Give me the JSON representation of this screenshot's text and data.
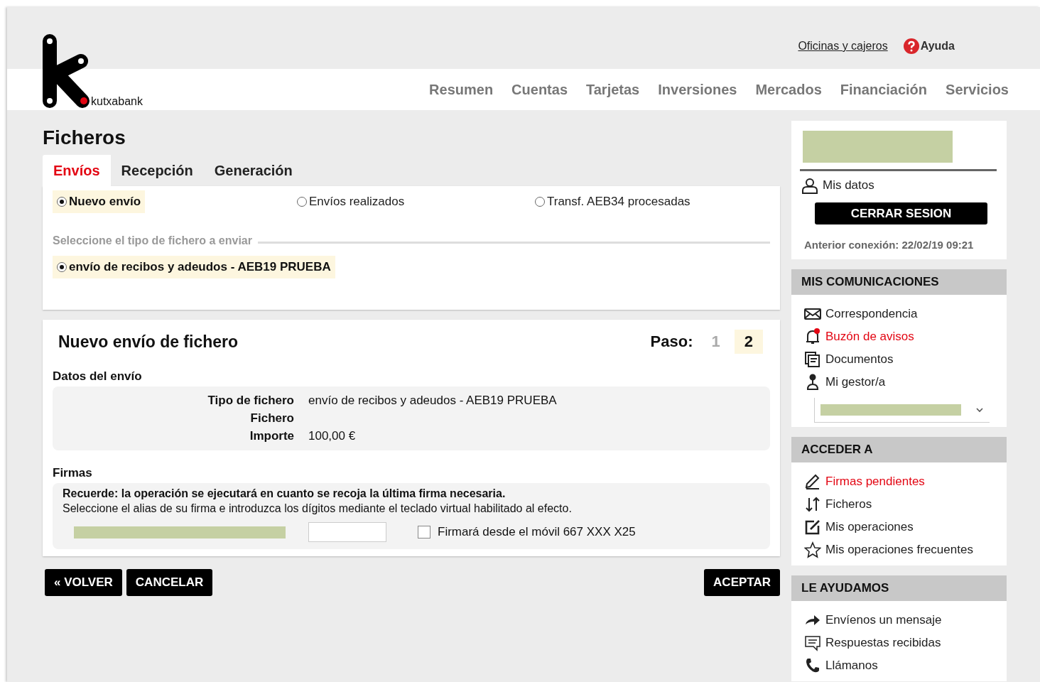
{
  "header": {
    "brand": "kutxabank",
    "top_links": [
      {
        "label": "Oficinas y cajeros",
        "kind": "link"
      },
      {
        "label": "Ayuda",
        "kind": "help"
      }
    ],
    "nav": [
      {
        "label": "Resumen"
      },
      {
        "label": "Cuentas"
      },
      {
        "label": "Tarjetas"
      },
      {
        "label": "Inversiones"
      },
      {
        "label": "Mercados"
      },
      {
        "label": "Financiación"
      },
      {
        "label": "Servicios"
      }
    ]
  },
  "page_title": "Ficheros",
  "tabs": [
    {
      "label": "Envíos",
      "selected": true
    },
    {
      "label": "Recepción",
      "selected": false
    },
    {
      "label": "Generación",
      "selected": false
    }
  ],
  "modes": [
    {
      "label": "Nuevo envío",
      "selected": true
    },
    {
      "label": "Envíos realizados",
      "selected": false
    },
    {
      "label": "Transf. AEB34 procesadas",
      "selected": false
    }
  ],
  "file_type_legend": "Seleccione el tipo de fichero a enviar",
  "file_types": [
    {
      "label": "envío de recibos y adeudos - AEB19 PRUEBA",
      "selected": true
    }
  ],
  "form": {
    "title": "Nuevo envío de fichero",
    "step_label": "Paso:",
    "steps": [
      {
        "label": "1",
        "selected": false
      },
      {
        "label": "2",
        "selected": true
      }
    ],
    "details_title": "Datos del envío",
    "details": [
      {
        "label": "Tipo de fichero",
        "value": "envío de recibos y adeudos - AEB19 PRUEBA"
      },
      {
        "label": "Fichero"
      },
      {
        "label": "Importe",
        "value": "100,00 €"
      }
    ],
    "signatures_title": "Firmas",
    "reminder": "Recuerde: la operación se ejecutará en cuanto se recoja la última firma necesaria.",
    "instructions": "Seleccione el alias de su firma e introduzca los dígitos mediante el teclado virtual habilitado al efecto.",
    "mobile_sign": {
      "label": "Firmará desde el móvil 667 XXX X25",
      "checked": false
    }
  },
  "buttons_left": [
    "« VOLVER",
    "CANCELAR"
  ],
  "button_right": "ACEPTAR",
  "sidebar": {
    "my_data": "Mis datos",
    "logout": "CERRAR SESION",
    "last_login": "Anterior conexión: 22/02/19 09:21",
    "sections": [
      {
        "title": "MIS COMUNICACIONES",
        "items": [
          {
            "label": "Correspondencia",
            "kind": "mail",
            "highlighted": false
          },
          {
            "label": "Buzón de avisos",
            "kind": "bell",
            "highlighted": true
          },
          {
            "label": "Documentos",
            "kind": "docs",
            "highlighted": false
          },
          {
            "label": "Mi gestor/a",
            "kind": "person",
            "highlighted": false
          }
        ],
        "has_select": true
      },
      {
        "title": "ACCEDER A",
        "items": [
          {
            "label": "Firmas pendientes",
            "kind": "pen",
            "highlighted": true
          },
          {
            "label": "Ficheros",
            "kind": "updown",
            "highlighted": false
          },
          {
            "label": "Mis operaciones",
            "kind": "edit",
            "highlighted": false
          },
          {
            "label": "Mis operaciones frecuentes",
            "kind": "star",
            "highlighted": false
          }
        ],
        "has_select": false
      },
      {
        "title": "LE AYUDAMOS",
        "items": [
          {
            "label": "Envíenos un mensaje",
            "kind": "arrow",
            "highlighted": false
          },
          {
            "label": "Respuestas recibidas",
            "kind": "chat",
            "highlighted": false
          },
          {
            "label": "Llámanos",
            "kind": "phone",
            "highlighted": false
          }
        ],
        "has_select": false
      }
    ]
  }
}
